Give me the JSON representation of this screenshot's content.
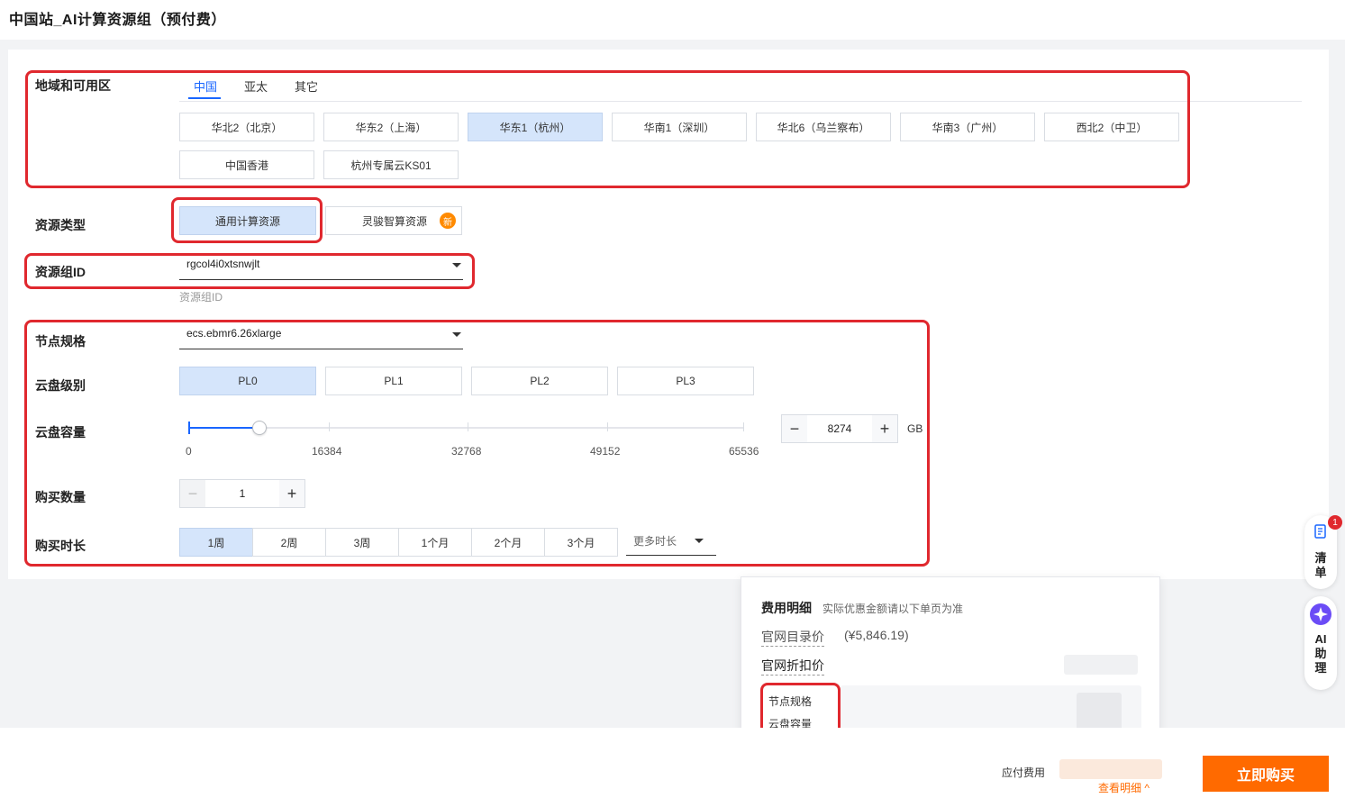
{
  "page": {
    "title": "中国站_AI计算资源组（预付费）"
  },
  "region": {
    "label": "地域和可用区",
    "tabs": [
      "中国",
      "亚太",
      "其它"
    ],
    "options": [
      "华北2（北京）",
      "华东2（上海）",
      "华东1（杭州）",
      "华南1（深圳）",
      "华北6（乌兰察布）",
      "华南3（广州）",
      "西北2（中卫）",
      "中国香港",
      "杭州专属云KS01"
    ],
    "selected": "华东1（杭州）"
  },
  "resource_type": {
    "label": "资源类型",
    "options": [
      "通用计算资源",
      "灵骏智算资源"
    ],
    "selected": "通用计算资源",
    "new_badge": "新"
  },
  "resource_group": {
    "label": "资源组ID",
    "value": "rgcol4i0xtsnwjlt",
    "hint": "资源组ID"
  },
  "node_spec": {
    "label": "节点规格",
    "value": "ecs.ebmr6.26xlarge"
  },
  "disk_level": {
    "label": "云盘级别",
    "options": [
      "PL0",
      "PL1",
      "PL2",
      "PL3"
    ],
    "selected": "PL0"
  },
  "disk_capacity": {
    "label": "云盘容量",
    "min": 0,
    "max": 65536,
    "ticks": [
      "0",
      "16384",
      "32768",
      "49152",
      "65536"
    ],
    "value": "8274",
    "value_num": 8274,
    "unit": "GB",
    "minus": "−",
    "plus": "+"
  },
  "quantity": {
    "label": "购买数量",
    "value": "1",
    "minus": "−",
    "plus": "+"
  },
  "duration": {
    "label": "购买时长",
    "options": [
      "1周",
      "2周",
      "3周",
      "1个月",
      "2个月",
      "3个月"
    ],
    "selected": "1周",
    "more": "更多时长"
  },
  "cost": {
    "title": "费用明细",
    "note": "实际优惠金额请以下单页为准",
    "list_price_label": "官网目录价",
    "list_price": "(¥5,846.19)",
    "discount_label": "官网折扣价",
    "items": [
      "节点规格",
      "云盘容量"
    ]
  },
  "footer": {
    "pay_label": "应付费用",
    "view_detail": "查看明细 ^",
    "buy": "立即购买"
  },
  "side": {
    "cart_label": "清单",
    "cart_badge": "1",
    "ai_label": "AI助理"
  },
  "colors": {
    "accent": "#1966ff",
    "highlight": "#e0282e",
    "buy": "#ff6a00",
    "selected_bg": "#d5e5fb"
  }
}
